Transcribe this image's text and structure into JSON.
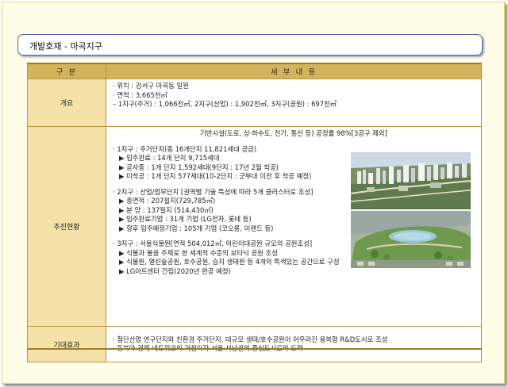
{
  "title": "개발호재 - 마곡지구",
  "table": {
    "header_col1": "구 분",
    "header_col2": "세 부 내 용",
    "rows": {
      "overview": {
        "label": "개요",
        "lines": [
          "· 위치 : 강서구 마곡동 일원",
          "· 면적 : 3,665천㎡",
          "– 1지구(주거) : 1,066천㎡, 2지구(산업) : 1,902천㎡, 3지구(공원) : 697천㎡"
        ]
      },
      "progress": {
        "label": "추진현황",
        "infra": "기반시설(도로, 상·하수도, 전기, 통신 등) 공정률 98%[3공구 제외]",
        "district1": [
          "· 1지구 : 주거단지(총 16개단지 11,821세대 공급)",
          "▶ 입주완료 : 14개 단지 9,715세대",
          "▶ 공사중 : 1개 단지 1,592세대(9단지 : 17년 2월 착공)",
          "▶ 미착공 : 1개 단지 577세대(10-2단지 : 군부대 이전 후 착공 예정)"
        ],
        "district2": [
          "· 2지구 : 산업/업무단지 [권역별 기술 특성에 따라 5개 클러스터로 조성]",
          "▶ 총면적 : 207필지(729,785㎡)",
          "▶ 분 양 : 137필지 (514,430㎡)",
          "▶ 입주완료기업 : 31개 기업 (LG전자, 롯데 등)",
          "▶ 향후 입주예정기업 : 105개 기업 (코오롱, 이랜드 등)"
        ],
        "district3": [
          "· 3지구 : 서울식물원[면적 504,012㎡, 어린이대공원 규모의 공원조성]",
          "▶ 식물과 물을 주제로 한 세계적 수준의 보타닉 공원 조성",
          "▶ 식물원, 열린숲공원, 호수공원, 습지 생태원 등 4개의 특색있는 공간으로 구성",
          "▶ LG아트센터 건립(2020년 완공 예정)"
        ]
      },
      "effect": {
        "label": "기대효과",
        "lines": [
          "· 첨단산업 연구단지와 친환경 주거단지, 대규모 생태/호수공원이 어우러진 융복합 R&D도시로 조성",
          "· 동북아 경제 네트워크의 거점이자 서울 서남권의 중심도시로의 도약"
        ]
      }
    }
  },
  "images": {
    "upper": "aerial-city-rendering",
    "lower": "park-masterplan-rendering"
  }
}
